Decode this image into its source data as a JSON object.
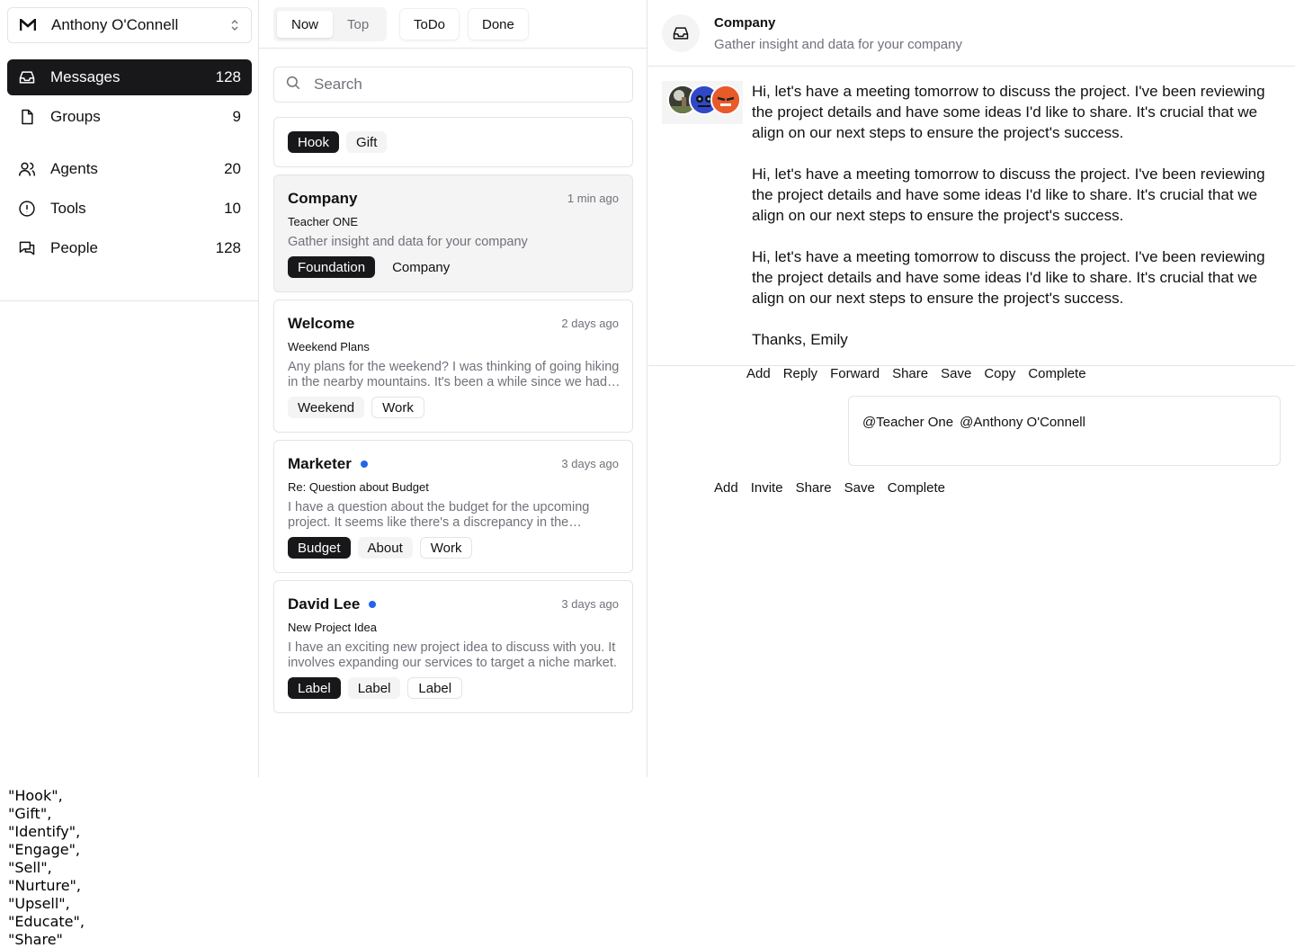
{
  "account": {
    "name": "Anthony O'Connell",
    "logo": "gmail-m-logo"
  },
  "sidebar": {
    "items": [
      {
        "label": "Messages",
        "count": "128",
        "icon": "inbox-icon",
        "active": true
      },
      {
        "label": "Groups",
        "count": "9",
        "icon": "file-icon"
      },
      {
        "label": "Agents",
        "count": "20",
        "icon": "users-icon"
      },
      {
        "label": "Tools",
        "count": "10",
        "icon": "alert-circle-icon"
      },
      {
        "label": "People",
        "count": "128",
        "icon": "messages-icon"
      }
    ]
  },
  "toolbar": {
    "segments": [
      "Now",
      "Top"
    ],
    "active_segment": "Now",
    "todo_label": "ToDo",
    "done_label": "Done"
  },
  "search": {
    "placeholder": "Search"
  },
  "filters": [
    "Hook",
    "Gift"
  ],
  "messages": [
    {
      "title": "Company",
      "time": "1 min ago",
      "subject": "Teacher ONE",
      "preview": "Gather insight and data for your company",
      "tags": [
        "Foundation",
        "Company"
      ],
      "selected": true,
      "unread": false
    },
    {
      "title": "Welcome",
      "time": "2 days ago",
      "subject": "Weekend Plans",
      "preview": "Any plans for the weekend? I was thinking of going hiking in the nearby mountains. It's been a while since we had some outdoor fun.",
      "tags": [
        "Weekend",
        "Work"
      ],
      "selected": false,
      "unread": false
    },
    {
      "title": "Marketer",
      "time": "3 days ago",
      "subject": "Re: Question about Budget",
      "preview": "I have a question about the budget for the upcoming project. It seems like there's a discrepancy in the allocation of resources.",
      "tags": [
        "Budget",
        "About",
        "Work"
      ],
      "selected": false,
      "unread": true
    },
    {
      "title": "David Lee",
      "time": "3 days ago",
      "subject": "New Project Idea",
      "preview": "I have an exciting new project idea to discuss with you. It involves expanding our services to target a niche market.",
      "tags": [
        "Label",
        "Label",
        "Label"
      ],
      "selected": false,
      "unread": true
    }
  ],
  "detail": {
    "title": "Company",
    "subtitle": "Gather insight and data for your company",
    "paragraphs": [
      "Hi, let's have a meeting tomorrow to discuss the project. I've been reviewing the project details and have some ideas I'd like to share. It's crucial that we align on our next steps to ensure the project's success.",
      "Hi, let's have a meeting tomorrow to discuss the project. I've been reviewing the project details and have some ideas I'd like to share. It's crucial that we align on our next steps to ensure the project's success.",
      "Hi, let's have a meeting tomorrow to discuss the project. I've been reviewing the project details and have some ideas I'd like to share. It's crucial that we align on our next steps to ensure the project's success.",
      "Thanks, Emily"
    ],
    "message_actions": [
      "Add",
      "Reply",
      "Forward",
      "Share",
      "Save",
      "Copy",
      "Complete"
    ],
    "mentions": [
      "@Teacher One",
      "@Anthony O'Connell"
    ],
    "compose_actions": [
      "Add",
      "Invite",
      "Share",
      "Save",
      "Complete"
    ]
  },
  "stray_list": [
    "\"Hook\",",
    "\"Gift\",",
    "\"Identify\",",
    "\"Engage\",",
    "\"Sell\",",
    "\"Nurture\",",
    "\"Upsell\",",
    "\"Educate\",",
    "\"Share\""
  ],
  "colors": {
    "accent_dark": "#18181b",
    "unread_dot": "#2563eb",
    "muted_text": "#71717a",
    "border": "#e4e4e7"
  }
}
